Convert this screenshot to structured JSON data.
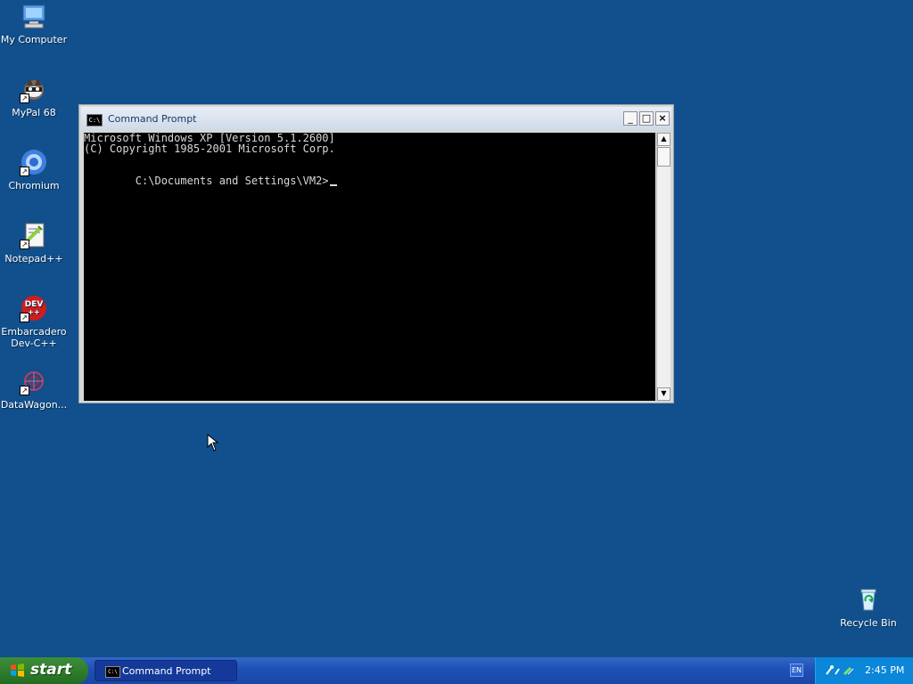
{
  "desktop": {
    "icons": [
      {
        "label": "My Computer",
        "icon": "computer-icon"
      },
      {
        "label": "MyPal 68",
        "icon": "raccoon-browser-icon"
      },
      {
        "label": "Chromium",
        "icon": "chromium-icon"
      },
      {
        "label": "Notepad++",
        "icon": "notepad-plus-plus-icon"
      },
      {
        "label": "Embarcadero Dev-C++",
        "icon": "devcpp-icon"
      },
      {
        "label": "DataWagon...",
        "icon": "datawagon-icon"
      },
      {
        "label": "Recycle Bin",
        "icon": "recycle-bin-icon"
      }
    ]
  },
  "window": {
    "title": "Command Prompt",
    "console_lines": [
      "Microsoft Windows XP [Version 5.1.2600]",
      "(C) Copyright 1985-2001 Microsoft Corp.",
      "",
      "C:\\Documents and Settings\\VM2>"
    ]
  },
  "taskbar": {
    "start_label": "start",
    "task_button_label": "Command Prompt",
    "language": "EN",
    "clock": "2:45 PM"
  },
  "colors": {
    "desktop_background": "#11508c",
    "taskbar_blue": "#1e50b5",
    "start_green": "#2f7f2d",
    "tray_blue": "#0b86d8"
  }
}
